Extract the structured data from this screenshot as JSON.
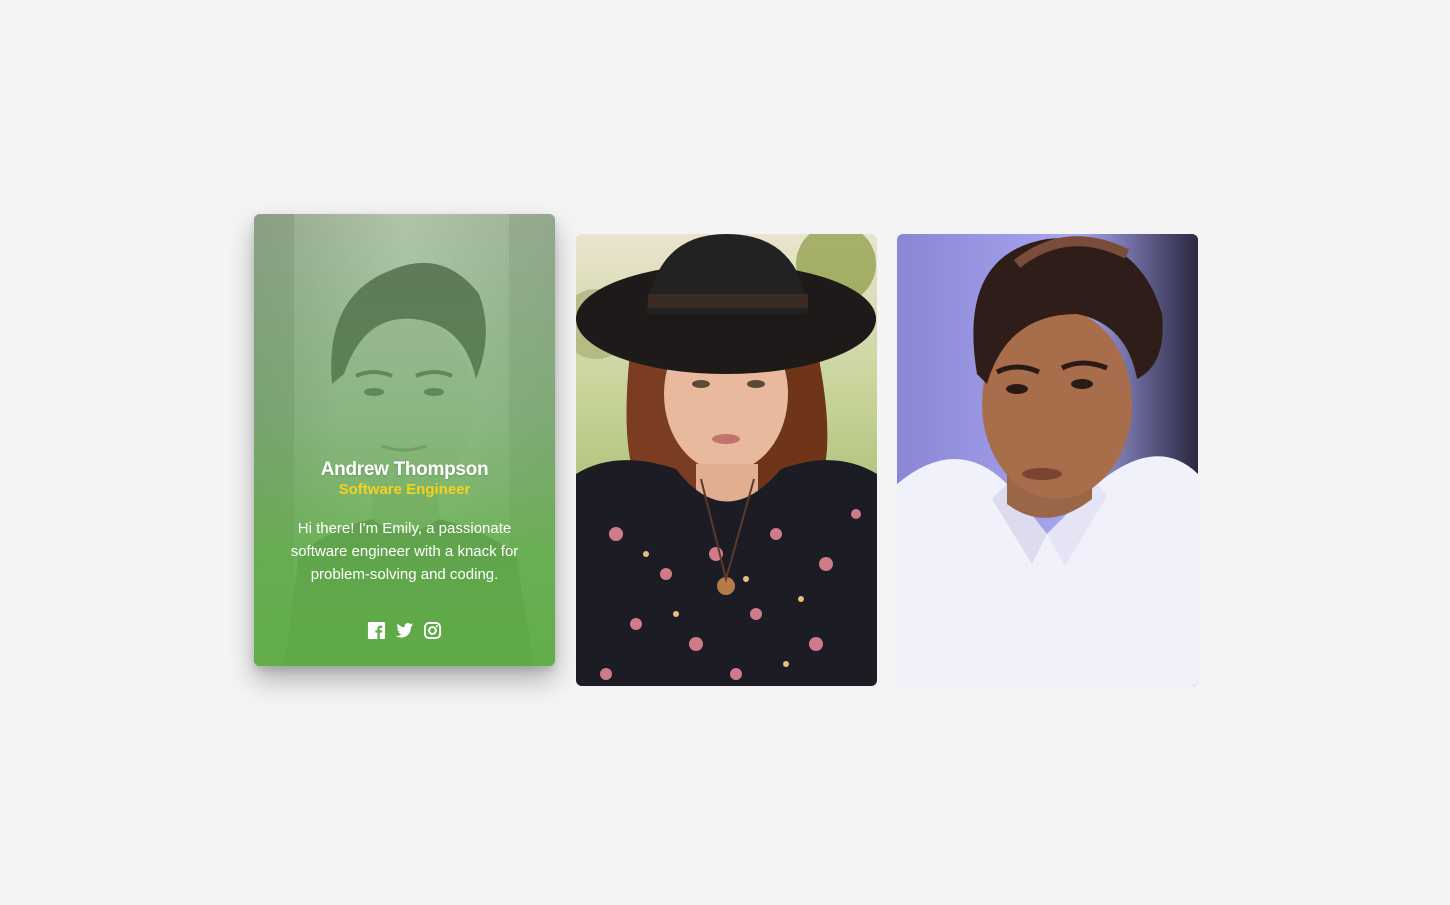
{
  "cards": [
    {
      "name": "Andrew Thompson",
      "role": "Software Engineer",
      "bio": "Hi there! I'm Emily, a passionate software engineer with a knack for problem-solving and coding.",
      "social": [
        "facebook-icon",
        "twitter-icon",
        "instagram-icon"
      ],
      "overlay_color": "#62b046",
      "role_color": "#f7d21b"
    },
    {
      "photo": "woman-in-black-hat-photo"
    },
    {
      "photo": "man-in-white-shirt-photo"
    }
  ]
}
